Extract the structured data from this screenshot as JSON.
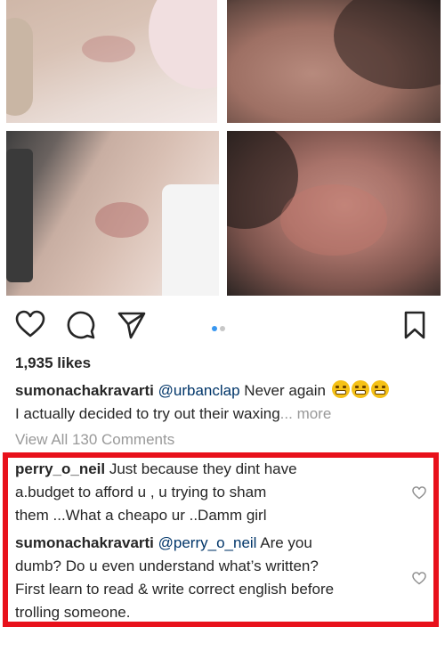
{
  "post": {
    "likes": "1,935 likes",
    "caption": {
      "username": "sumonachakravarti",
      "mention": "@urbanclap",
      "text1": " Never again ",
      "line2": "I actually decided to try out their waxing",
      "ellipsis": "...",
      "more": " more"
    },
    "view_all": "View All 130 Comments",
    "carousel": {
      "current": 1,
      "total": 2,
      "active_color": "#3897f0",
      "inactive_color": "#c7c7c7"
    }
  },
  "icons": [
    "heart-icon",
    "comment-icon",
    "share-icon",
    "bookmark-icon",
    "grimace-emoji-icon"
  ],
  "comments": [
    {
      "username": "perry_o_neil",
      "line1": " Just because they dint have",
      "line2": "a.budget to afford u , u trying to sham",
      "line3": "them ...What a cheapo ur ..Damm girl"
    },
    {
      "username": "sumonachakravarti",
      "mention": "@perry_o_neil",
      "line1_rest": " Are you",
      "line2": "dumb? Do u even understand what’s written?",
      "line3": "First learn to read & write correct english before",
      "line4": "trolling someone."
    }
  ],
  "colors": {
    "highlight_border": "#e8111b",
    "mention": "#003569",
    "muted": "#999999"
  }
}
